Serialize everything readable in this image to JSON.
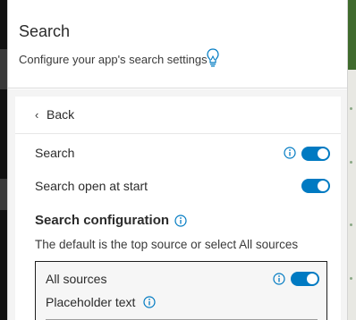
{
  "header": {
    "title": "Search",
    "subtitle": "Configure your app's search settings",
    "tip_icon": "lightbulb-icon"
  },
  "nav": {
    "back_chevron": "‹",
    "back_label": "Back"
  },
  "settings": {
    "search": {
      "label": "Search",
      "enabled": true,
      "info_icon": "info-icon"
    },
    "search_open_at_start": {
      "label": "Search open at start",
      "enabled": true
    }
  },
  "search_configuration": {
    "title": "Search configuration",
    "description": "The default is the top source or select All sources",
    "all_sources": {
      "label": "All sources",
      "enabled": true
    },
    "placeholder_text": {
      "label": "Placeholder text",
      "value": ""
    }
  },
  "colors": {
    "accent": "#007ac2",
    "panel_bg": "#ffffff",
    "text": "#2b2b2b"
  }
}
